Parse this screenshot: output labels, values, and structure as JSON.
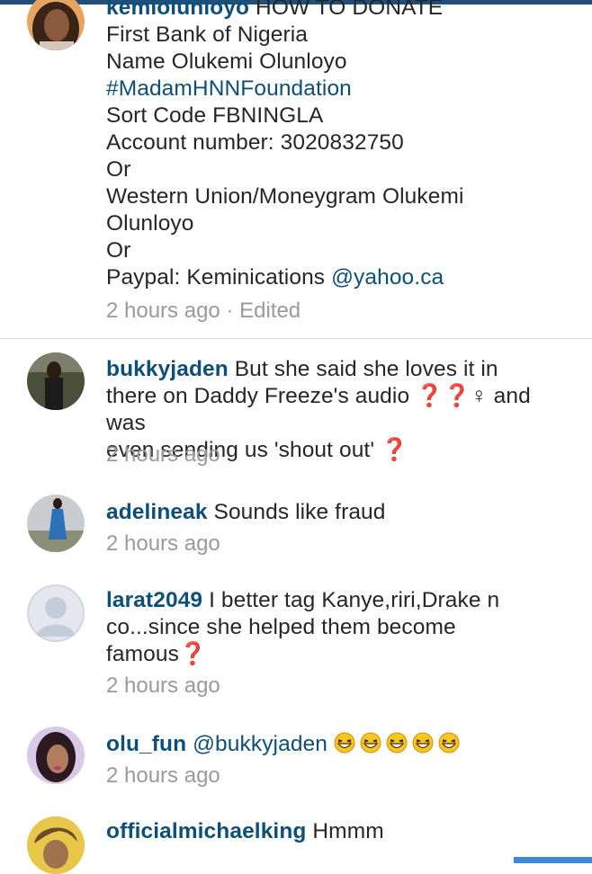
{
  "comments": [
    {
      "username": "kemiolunloyo",
      "lines": [
        "HOW TO DONATE",
        "First Bank of Nigeria",
        "Name Olukemi Olunloyo",
        "#MadamHNNFoundation",
        "Sort Code FBNINGLA",
        "Account number: 3020832750",
        "Or",
        "Western Union/Moneygram Olukemi",
        "Olunloyo",
        "Or",
        "Paypal: Keminications ",
        "@yahoo.ca"
      ],
      "time": "2 hours ago · Edited"
    },
    {
      "username": "bukkyjaden",
      "text1": "But she said she loves it in",
      "text2": "there on Daddy Freeze's audio ❓❓♀ and was",
      "text3": "even sending us 'shout out' ❓",
      "time": "2 hours ago"
    },
    {
      "username": "adelineak",
      "text1": "Sounds like fraud",
      "time": "2 hours ago"
    },
    {
      "username": "larat2049",
      "text1": "I better tag Kanye,riri,Drake n",
      "text2": "co...since she helped them become",
      "text3": "famous❓",
      "time": "2 hours ago"
    },
    {
      "username": "olu_fun",
      "mention": "@bukkyjaden",
      "emoji_count": 5,
      "emoji_icon": "grinning-squinting-face-icon",
      "time": "2 hours ago"
    },
    {
      "username": "officialmichaelking",
      "text1": "Hmmm"
    }
  ],
  "colors": {
    "username": "#0e4f79",
    "link": "#0e4f79",
    "timestamp": "#9a9a9a",
    "text": "#262626",
    "top_bar": "#1f4f7a",
    "bottom_bar": "#3f8ad6"
  }
}
